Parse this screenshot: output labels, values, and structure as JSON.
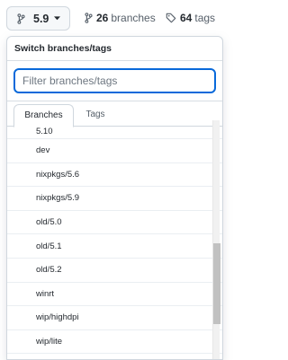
{
  "ref_selector": {
    "current": "5.9"
  },
  "stats": {
    "branches_count": "26",
    "branches_label": "branches",
    "tags_count": "64",
    "tags_label": "tags"
  },
  "dropdown": {
    "title": "Switch branches/tags",
    "filter_placeholder": "Filter branches/tags",
    "filter_value": "",
    "tabs": [
      {
        "label": "Branches",
        "active": true
      },
      {
        "label": "Tags",
        "active": false
      }
    ],
    "branches": [
      "5.10",
      "dev",
      "nixpkgs/5.6",
      "nixpkgs/5.9",
      "old/5.0",
      "old/5.1",
      "old/5.2",
      "winrt",
      "wip/highdpi",
      "wip/lite"
    ]
  },
  "colors": {
    "accent": "#0969da",
    "border": "#d0d7de",
    "muted": "#57606a"
  }
}
